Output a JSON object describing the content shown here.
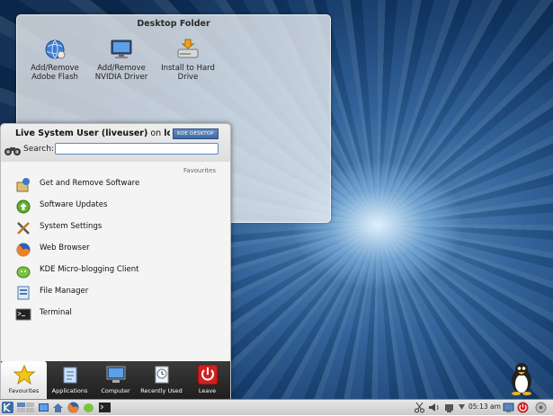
{
  "desktop_folder": {
    "title": "Desktop Folder",
    "icons": [
      {
        "label_line1": "Add/Remove",
        "label_line2": "Adobe Flash",
        "icon": "globe-icon"
      },
      {
        "label_line1": "Add/Remove",
        "label_line2": "NVIDIA Driver",
        "icon": "monitor-icon"
      },
      {
        "label_line1": "Install to Hard",
        "label_line2": "Drive",
        "icon": "hard-drive-icon"
      }
    ]
  },
  "menu": {
    "user_name": "Live System User (liveuser)",
    "on_text": "on",
    "host": "localhost",
    "badge": "KDE DESKTOP",
    "search_label": "Search:",
    "search_value": "",
    "section_caption": "Favourites",
    "items": [
      {
        "label": "Get and Remove Software",
        "icon": "package-icon"
      },
      {
        "label": "Software Updates",
        "icon": "update-icon"
      },
      {
        "label": "System Settings",
        "icon": "settings-tools-icon"
      },
      {
        "label": "Web Browser",
        "icon": "firefox-icon"
      },
      {
        "label": "KDE Micro-blogging Client",
        "icon": "microblog-icon"
      },
      {
        "label": "File Manager",
        "icon": "file-manager-icon"
      },
      {
        "label": "Terminal",
        "icon": "terminal-icon"
      }
    ],
    "tabs": [
      {
        "label": "Favourites",
        "icon": "star-icon",
        "active": true
      },
      {
        "label": "Applications",
        "icon": "applications-icon",
        "active": false
      },
      {
        "label": "Computer",
        "icon": "computer-icon",
        "active": false
      },
      {
        "label": "Recently Used",
        "icon": "clock-icon",
        "active": false
      },
      {
        "label": "Leave",
        "icon": "power-icon",
        "active": false
      }
    ]
  },
  "panel": {
    "clock": "05:13 am"
  },
  "colors": {
    "accent": "#3f6aa3",
    "leave_red": "#d02020",
    "star_yellow": "#f3c617"
  }
}
